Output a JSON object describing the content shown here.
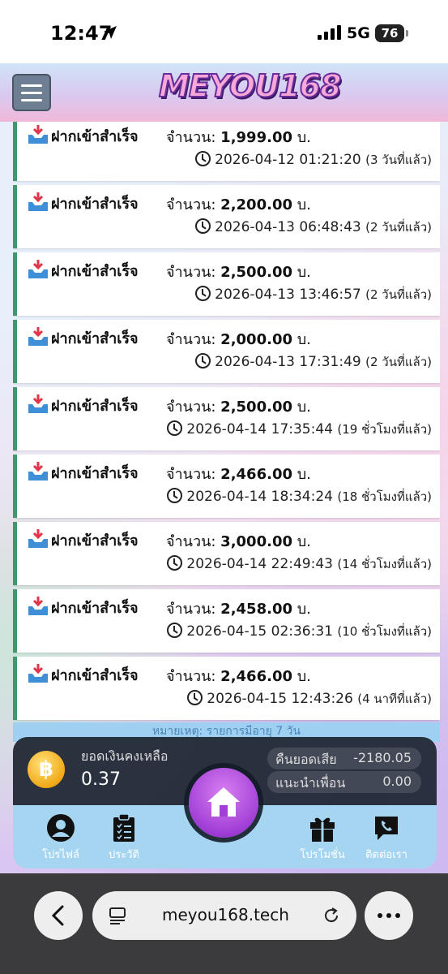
{
  "status_bar": {
    "time": "12:47",
    "network": "5G",
    "battery": "76"
  },
  "header": {
    "logo_text": "MEYOU168"
  },
  "transactions": [
    {
      "status": "ฝากเข้าสำเร็จ",
      "amount_label": "จำนวน:",
      "amount": "1,999.00",
      "currency": "บ.",
      "datetime": "2026-04-12 01:21:20",
      "relative": "(3 วันที่แล้ว)"
    },
    {
      "status": "ฝากเข้าสำเร็จ",
      "amount_label": "จำนวน:",
      "amount": "2,200.00",
      "currency": "บ.",
      "datetime": "2026-04-13 06:48:43",
      "relative": "(2 วันที่แล้ว)"
    },
    {
      "status": "ฝากเข้าสำเร็จ",
      "amount_label": "จำนวน:",
      "amount": "2,500.00",
      "currency": "บ.",
      "datetime": "2026-04-13 13:46:57",
      "relative": "(2 วันที่แล้ว)"
    },
    {
      "status": "ฝากเข้าสำเร็จ",
      "amount_label": "จำนวน:",
      "amount": "2,000.00",
      "currency": "บ.",
      "datetime": "2026-04-13 17:31:49",
      "relative": "(2 วันที่แล้ว)"
    },
    {
      "status": "ฝากเข้าสำเร็จ",
      "amount_label": "จำนวน:",
      "amount": "2,500.00",
      "currency": "บ.",
      "datetime": "2026-04-14 17:35:44",
      "relative": "(19 ชั่วโมงที่แล้ว)"
    },
    {
      "status": "ฝากเข้าสำเร็จ",
      "amount_label": "จำนวน:",
      "amount": "2,466.00",
      "currency": "บ.",
      "datetime": "2026-04-14 18:34:24",
      "relative": "(18 ชั่วโมงที่แล้ว)"
    },
    {
      "status": "ฝากเข้าสำเร็จ",
      "amount_label": "จำนวน:",
      "amount": "3,000.00",
      "currency": "บ.",
      "datetime": "2026-04-14 22:49:43",
      "relative": "(14 ชั่วโมงที่แล้ว)"
    },
    {
      "status": "ฝากเข้าสำเร็จ",
      "amount_label": "จำนวน:",
      "amount": "2,458.00",
      "currency": "บ.",
      "datetime": "2026-04-15 02:36:31",
      "relative": "(10 ชั่วโมงที่แล้ว)"
    },
    {
      "status": "ฝากเข้าสำเร็จ",
      "amount_label": "จำนวน:",
      "amount": "2,466.00",
      "currency": "บ.",
      "datetime": "2026-04-15 12:43:26",
      "relative": "(4 นาทีที่แล้ว)"
    }
  ],
  "note": "หมายเหตุ: รายการมีอายุ 7 วัน",
  "balance": {
    "label": "ยอดเงินคงเหลือ",
    "value": "0.37",
    "coin_symbol": "฿",
    "cashback_label": "คืนยอดเสีย",
    "cashback_value": "-2180.05",
    "referral_label": "แนะนำเพื่อน",
    "referral_value": "0.00"
  },
  "bottom_nav": {
    "profile": "โปรไฟล์",
    "history": "ประวัติ",
    "promotion": "โปรโมชั่น",
    "contact": "ติดต่อเรา"
  },
  "browser": {
    "url": "meyou168.tech"
  },
  "icons": {
    "status": [
      "location-arrow-icon",
      "signal-icon",
      "battery-icon"
    ],
    "header": [
      "hamburger-menu-icon"
    ],
    "list": [
      "deposit-inbox-icon",
      "clock-icon"
    ],
    "nav": [
      "user-icon",
      "clipboard-icon",
      "home-icon",
      "gift-icon",
      "phone-chat-icon"
    ],
    "browser": [
      "back-chevron-icon",
      "tabs-icon",
      "reload-icon",
      "more-dots-icon"
    ]
  },
  "colors": {
    "deposit_border": "#3c9a6a",
    "nav_background": "#a6d5f2",
    "home_button": "#a13fd6",
    "balance_panel": "#1c2430"
  }
}
